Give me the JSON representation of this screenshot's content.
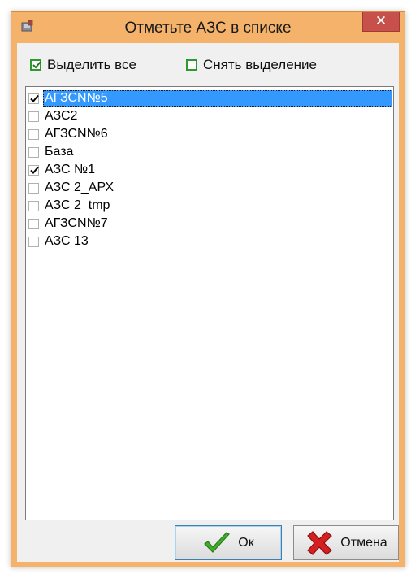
{
  "window": {
    "title": "Отметьте АЗС в списке",
    "close_glyph": "✕"
  },
  "toolbar": {
    "select_all_label": "Выделить все",
    "deselect_label": "Снять выделение"
  },
  "list": {
    "items": [
      {
        "label": "АГЗСN№5",
        "checked": true,
        "selected": true
      },
      {
        "label": "АЗС2",
        "checked": false,
        "selected": false
      },
      {
        "label": "АГЗСN№6",
        "checked": false,
        "selected": false
      },
      {
        "label": "База",
        "checked": false,
        "selected": false
      },
      {
        "label": "АЗС №1",
        "checked": true,
        "selected": false
      },
      {
        "label": "АЗС 2_АРХ",
        "checked": false,
        "selected": false
      },
      {
        "label": "АЗС 2_tmp",
        "checked": false,
        "selected": false
      },
      {
        "label": "АГЗСN№7",
        "checked": false,
        "selected": false
      },
      {
        "label": "АЗС 13",
        "checked": false,
        "selected": false
      }
    ]
  },
  "buttons": {
    "ok_label": "Ок",
    "cancel_label": "Отмена"
  },
  "colors": {
    "title_bar": "#f4b26a",
    "close_button": "#c7504a",
    "selection": "#3399ff",
    "toolbar_box": "#2e9a2e",
    "ok_icon": "#3fae2a",
    "cancel_icon": "#d42020"
  },
  "icons": {
    "app": "app-icon",
    "close": "close-icon",
    "select_all": "checked-box-icon",
    "deselect": "empty-box-icon",
    "ok": "green-check-icon",
    "cancel": "red-x-icon"
  }
}
